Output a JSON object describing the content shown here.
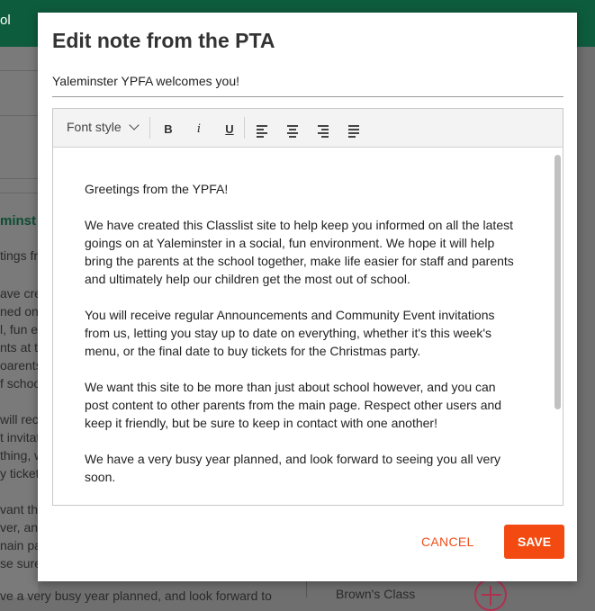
{
  "background": {
    "topbar_fragment": "ol",
    "heading_fragment": "minst",
    "text_fragments": [
      "tings fro",
      "ave cre",
      "ned on",
      "l, fun e",
      "nts at th",
      "oarents",
      "f schoo",
      "will rece",
      "t invitat",
      "thing, w",
      "y ticket",
      "vant this",
      "ver, an",
      "nain pag",
      "se sure t"
    ],
    "bottom_text": "ve a very busy year planned, and look forward to",
    "class_label": "Brown's Class"
  },
  "modal": {
    "title": "Edit note from the PTA",
    "subject_value": "Yaleminster YPFA welcomes you!",
    "toolbar": {
      "font_style_label": "Font style",
      "bold_label": "B",
      "italic_label": "i",
      "underline_label": "U"
    },
    "content": {
      "paragraphs": [
        "Greetings from the YPFA!",
        "We have created this Classlist site to help keep you informed on all the latest goings on at Yaleminster in a social, fun environment. We hope it will help bring the parents at the school together, make life easier for staff and parents and ultimately help our children get the most out of school.",
        "You will receive regular Announcements and Community Event invitations from us, letting you stay up to date on everything, whether it's this week's menu, or the final date to buy tickets for the Christmas party.",
        "We want this site to be more than just about school however, and you can post content to other parents from the main page. Respect other users and keep it friendly, but be sure to keep in contact with one another!",
        "We have a very busy year planned, and look forward to seeing you all very soon."
      ]
    },
    "cancel_label": "CANCEL",
    "save_label": "SAVE"
  },
  "colors": {
    "accent": "#f24a10",
    "topbar": "#0e5c3e"
  }
}
